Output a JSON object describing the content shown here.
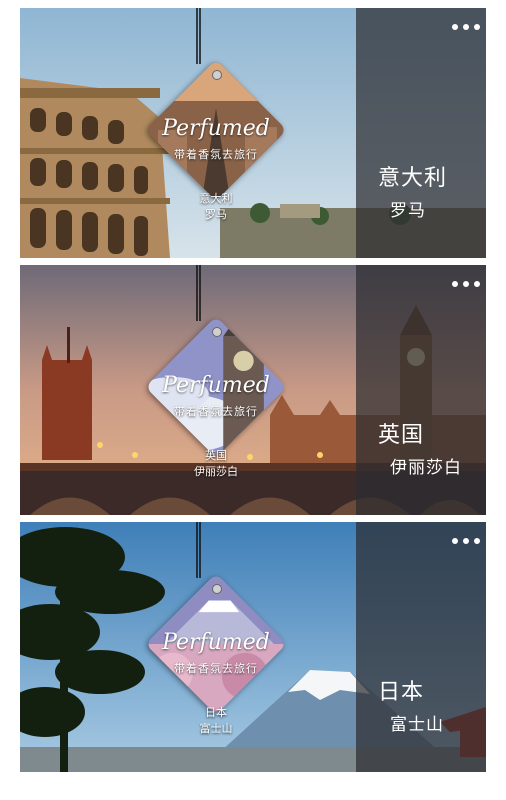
{
  "cards": [
    {
      "country": "意大利",
      "city": "罗马",
      "brand": "Perfumed",
      "slogan": "带着香氛去旅行",
      "tag_country": "意大利",
      "tag_city": "罗马",
      "menu_icon": "more-dots-icon"
    },
    {
      "country": "英国",
      "city": "伊丽莎白",
      "brand": "Perfumed",
      "slogan": "带着香氛去旅行",
      "tag_country": "英国",
      "tag_city": "伊丽莎白",
      "menu_icon": "more-dots-icon"
    },
    {
      "country": "日本",
      "city": "富士山",
      "brand": "Perfumed",
      "slogan": "带着香氛去旅行",
      "tag_country": "日本",
      "tag_city": "富士山",
      "menu_icon": "more-dots-icon"
    }
  ]
}
